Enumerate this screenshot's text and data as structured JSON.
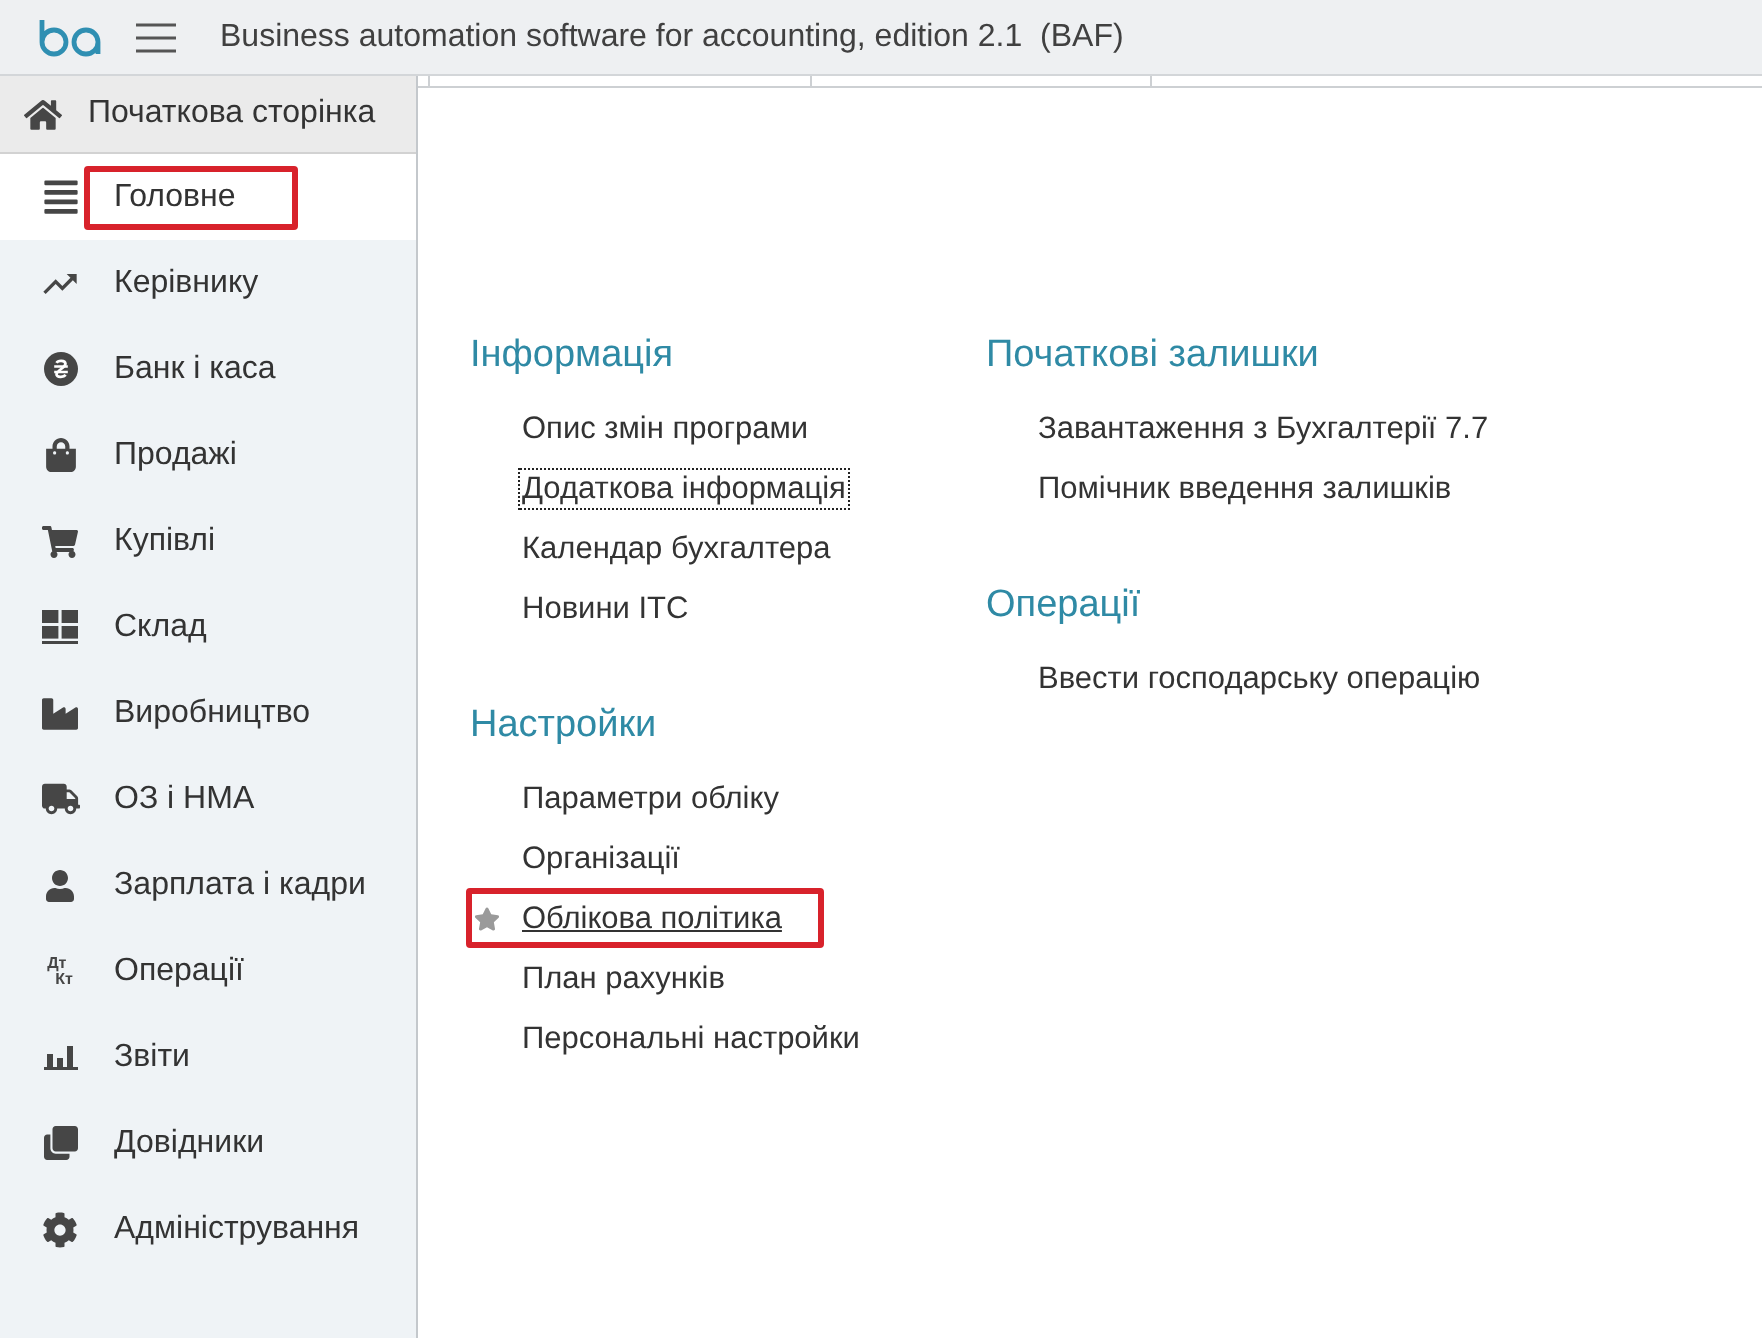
{
  "window": {
    "title": "Business automation software for accounting, edition 2.1  (BAF)"
  },
  "home": {
    "label": "Початкова сторінка"
  },
  "sidebar": {
    "items": [
      {
        "label": "Головне",
        "selected": true,
        "highlighted": true
      },
      {
        "label": "Керівнику",
        "selected": false,
        "highlighted": false
      },
      {
        "label": "Банк і каса",
        "selected": false,
        "highlighted": false
      },
      {
        "label": "Продажі",
        "selected": false,
        "highlighted": false
      },
      {
        "label": "Купівлі",
        "selected": false,
        "highlighted": false
      },
      {
        "label": "Склад",
        "selected": false,
        "highlighted": false
      },
      {
        "label": "Виробництво",
        "selected": false,
        "highlighted": false
      },
      {
        "label": "ОЗ і НМА",
        "selected": false,
        "highlighted": false
      },
      {
        "label": "Зарплата і кадри",
        "selected": false,
        "highlighted": false
      },
      {
        "label": "Операції",
        "selected": false,
        "highlighted": false,
        "icon_text": [
          "Дт",
          "Кт"
        ]
      },
      {
        "label": "Звіти",
        "selected": false,
        "highlighted": false
      },
      {
        "label": "Довідники",
        "selected": false,
        "highlighted": false
      },
      {
        "label": "Адміністрування",
        "selected": false,
        "highlighted": false
      }
    ]
  },
  "columns": [
    {
      "sections": [
        {
          "title": "Інформація",
          "links": [
            {
              "label": "Опис змін програми",
              "focused": false,
              "hovered": false,
              "favorite": false,
              "highlighted": false
            },
            {
              "label": "Додаткова інформація",
              "focused": true,
              "hovered": false,
              "favorite": false,
              "highlighted": false
            },
            {
              "label": "Календар бухгалтера",
              "focused": false,
              "hovered": false,
              "favorite": false,
              "highlighted": false
            },
            {
              "label": "Новини ІТС",
              "focused": false,
              "hovered": false,
              "favorite": false,
              "highlighted": false
            }
          ]
        },
        {
          "title": "Настройки",
          "links": [
            {
              "label": "Параметри обліку",
              "focused": false,
              "hovered": false,
              "favorite": false,
              "highlighted": false
            },
            {
              "label": "Організації",
              "focused": false,
              "hovered": false,
              "favorite": false,
              "highlighted": false
            },
            {
              "label": "Облікова політика",
              "focused": false,
              "hovered": true,
              "favorite": true,
              "highlighted": true
            },
            {
              "label": "План рахунків",
              "focused": false,
              "hovered": false,
              "favorite": false,
              "highlighted": false
            },
            {
              "label": "Персональні настройки",
              "focused": false,
              "hovered": false,
              "favorite": false,
              "highlighted": false
            }
          ]
        }
      ]
    },
    {
      "sections": [
        {
          "title": "Початкові залишки",
          "links": [
            {
              "label": "Завантаження з Бухгалтерії 7.7",
              "focused": false,
              "hovered": false,
              "favorite": false,
              "highlighted": false
            },
            {
              "label": "Помічник введення залишків",
              "focused": false,
              "hovered": false,
              "favorite": false,
              "highlighted": false
            }
          ]
        },
        {
          "title": "Операції",
          "links": [
            {
              "label": "Ввести господарську операцію",
              "focused": false,
              "hovered": false,
              "favorite": false,
              "highlighted": false
            }
          ]
        }
      ]
    }
  ]
}
